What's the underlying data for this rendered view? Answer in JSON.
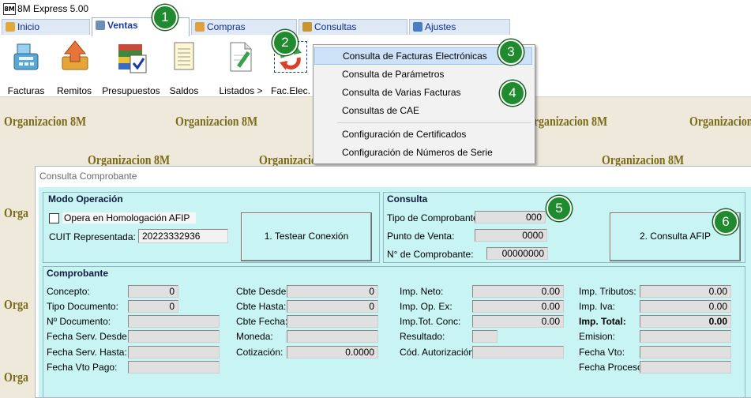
{
  "window": {
    "title": "8M Express 5.00",
    "logo": "8M"
  },
  "tabs": [
    {
      "label": "Inicio"
    },
    {
      "label": "Ventas"
    },
    {
      "label": "Compras"
    },
    {
      "label": "Consultas"
    },
    {
      "label": "Ajustes"
    }
  ],
  "toolbar": [
    {
      "label": "Facturas",
      "icon": "cash-register-icon"
    },
    {
      "label": "Remitos",
      "icon": "upload-box-icon"
    },
    {
      "label": "Presupuestos",
      "icon": "books-check-icon"
    },
    {
      "label": "Saldos",
      "icon": "notepad-icon"
    },
    {
      "label": "Listados >",
      "icon": "document-edit-icon"
    },
    {
      "label": "Fac.Elec.",
      "icon": "refresh-arrows-icon"
    }
  ],
  "watermark": "Organizacion 8M",
  "badges": [
    "1",
    "2",
    "3",
    "4",
    "5",
    "6"
  ],
  "menu": [
    {
      "label": "Consulta de Facturas Electrónicas"
    },
    {
      "label": "Consulta de Parámetros"
    },
    {
      "label": "Consulta de Varias Facturas"
    },
    {
      "label": "Consultas de CAE"
    },
    {
      "label": "Configuración de Certificados"
    },
    {
      "label": "Configuración de Números de Serie"
    }
  ],
  "dialog": {
    "title": "Consulta Comprobante",
    "modo": {
      "title": "Modo Operación",
      "homologacion_label": "Opera en Homologación AFIP",
      "cuit_label": "CUIT Representada:",
      "cuit_value": "20223332936",
      "test_button": "1. Testear Conexión"
    },
    "consulta": {
      "title": "Consulta",
      "tipo_label": "Tipo de Comprobante:",
      "tipo_value": "000",
      "punto_label": "Punto de Venta:",
      "punto_value": "0000",
      "numero_label": "N° de  Comprobante:",
      "numero_value": "00000000",
      "afip_button": "2. Consulta AFIP"
    },
    "comprobante": {
      "title": "Comprobante",
      "col1": [
        {
          "label": "Concepto:",
          "value": "0"
        },
        {
          "label": "Tipo Documento:",
          "value": "0"
        },
        {
          "label": "Nº Documento:",
          "value": ""
        },
        {
          "label": "Fecha Serv. Desde:",
          "value": ""
        },
        {
          "label": "Fecha Serv. Hasta:",
          "value": ""
        },
        {
          "label": "Fecha Vto Pago:",
          "value": ""
        }
      ],
      "col2": [
        {
          "label": "Cbte Desde:",
          "value": "0"
        },
        {
          "label": "Cbte Hasta:",
          "value": "0"
        },
        {
          "label": "Cbte Fecha:",
          "value": ""
        },
        {
          "label": "Moneda:",
          "value": ""
        },
        {
          "label": "Cotización:",
          "value": "0.0000"
        }
      ],
      "col3": [
        {
          "label": "Imp. Neto:",
          "value": "0.00"
        },
        {
          "label": "Imp. Op. Ex:",
          "value": "0.00"
        },
        {
          "label": "Imp.Tot. Conc:",
          "value": "0.00"
        },
        {
          "label": "Resultado:",
          "value": ""
        },
        {
          "label": "Cód. Autorización:",
          "value": ""
        }
      ],
      "col4": [
        {
          "label": "Imp. Tributos:",
          "value": "0.00"
        },
        {
          "label": "Imp. Iva:",
          "value": "0.00"
        },
        {
          "label": "Imp. Total:",
          "value": "0.00"
        },
        {
          "label": "Emision:",
          "value": ""
        },
        {
          "label": "Fecha Vto:",
          "value": ""
        },
        {
          "label": "Fecha Proceso:",
          "value": ""
        }
      ]
    }
  }
}
